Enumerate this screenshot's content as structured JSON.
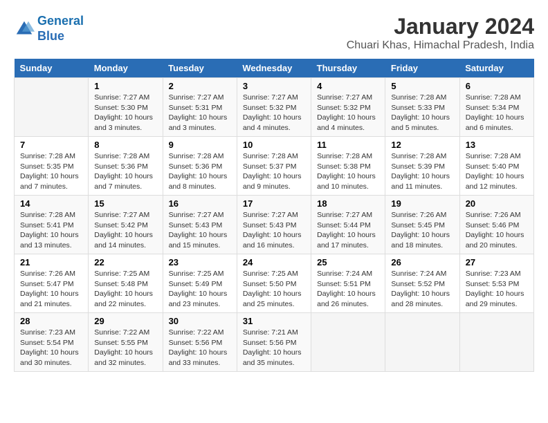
{
  "header": {
    "logo_line1": "General",
    "logo_line2": "Blue",
    "month": "January 2024",
    "location": "Chuari Khas, Himachal Pradesh, India"
  },
  "days_of_week": [
    "Sunday",
    "Monday",
    "Tuesday",
    "Wednesday",
    "Thursday",
    "Friday",
    "Saturday"
  ],
  "weeks": [
    [
      {
        "day": "",
        "info": ""
      },
      {
        "day": "1",
        "info": "Sunrise: 7:27 AM\nSunset: 5:30 PM\nDaylight: 10 hours and 3 minutes."
      },
      {
        "day": "2",
        "info": "Sunrise: 7:27 AM\nSunset: 5:31 PM\nDaylight: 10 hours and 3 minutes."
      },
      {
        "day": "3",
        "info": "Sunrise: 7:27 AM\nSunset: 5:32 PM\nDaylight: 10 hours and 4 minutes."
      },
      {
        "day": "4",
        "info": "Sunrise: 7:27 AM\nSunset: 5:32 PM\nDaylight: 10 hours and 4 minutes."
      },
      {
        "day": "5",
        "info": "Sunrise: 7:28 AM\nSunset: 5:33 PM\nDaylight: 10 hours and 5 minutes."
      },
      {
        "day": "6",
        "info": "Sunrise: 7:28 AM\nSunset: 5:34 PM\nDaylight: 10 hours and 6 minutes."
      }
    ],
    [
      {
        "day": "7",
        "info": "Sunrise: 7:28 AM\nSunset: 5:35 PM\nDaylight: 10 hours and 7 minutes."
      },
      {
        "day": "8",
        "info": "Sunrise: 7:28 AM\nSunset: 5:36 PM\nDaylight: 10 hours and 7 minutes."
      },
      {
        "day": "9",
        "info": "Sunrise: 7:28 AM\nSunset: 5:36 PM\nDaylight: 10 hours and 8 minutes."
      },
      {
        "day": "10",
        "info": "Sunrise: 7:28 AM\nSunset: 5:37 PM\nDaylight: 10 hours and 9 minutes."
      },
      {
        "day": "11",
        "info": "Sunrise: 7:28 AM\nSunset: 5:38 PM\nDaylight: 10 hours and 10 minutes."
      },
      {
        "day": "12",
        "info": "Sunrise: 7:28 AM\nSunset: 5:39 PM\nDaylight: 10 hours and 11 minutes."
      },
      {
        "day": "13",
        "info": "Sunrise: 7:28 AM\nSunset: 5:40 PM\nDaylight: 10 hours and 12 minutes."
      }
    ],
    [
      {
        "day": "14",
        "info": "Sunrise: 7:28 AM\nSunset: 5:41 PM\nDaylight: 10 hours and 13 minutes."
      },
      {
        "day": "15",
        "info": "Sunrise: 7:27 AM\nSunset: 5:42 PM\nDaylight: 10 hours and 14 minutes."
      },
      {
        "day": "16",
        "info": "Sunrise: 7:27 AM\nSunset: 5:43 PM\nDaylight: 10 hours and 15 minutes."
      },
      {
        "day": "17",
        "info": "Sunrise: 7:27 AM\nSunset: 5:43 PM\nDaylight: 10 hours and 16 minutes."
      },
      {
        "day": "18",
        "info": "Sunrise: 7:27 AM\nSunset: 5:44 PM\nDaylight: 10 hours and 17 minutes."
      },
      {
        "day": "19",
        "info": "Sunrise: 7:26 AM\nSunset: 5:45 PM\nDaylight: 10 hours and 18 minutes."
      },
      {
        "day": "20",
        "info": "Sunrise: 7:26 AM\nSunset: 5:46 PM\nDaylight: 10 hours and 20 minutes."
      }
    ],
    [
      {
        "day": "21",
        "info": "Sunrise: 7:26 AM\nSunset: 5:47 PM\nDaylight: 10 hours and 21 minutes."
      },
      {
        "day": "22",
        "info": "Sunrise: 7:25 AM\nSunset: 5:48 PM\nDaylight: 10 hours and 22 minutes."
      },
      {
        "day": "23",
        "info": "Sunrise: 7:25 AM\nSunset: 5:49 PM\nDaylight: 10 hours and 23 minutes."
      },
      {
        "day": "24",
        "info": "Sunrise: 7:25 AM\nSunset: 5:50 PM\nDaylight: 10 hours and 25 minutes."
      },
      {
        "day": "25",
        "info": "Sunrise: 7:24 AM\nSunset: 5:51 PM\nDaylight: 10 hours and 26 minutes."
      },
      {
        "day": "26",
        "info": "Sunrise: 7:24 AM\nSunset: 5:52 PM\nDaylight: 10 hours and 28 minutes."
      },
      {
        "day": "27",
        "info": "Sunrise: 7:23 AM\nSunset: 5:53 PM\nDaylight: 10 hours and 29 minutes."
      }
    ],
    [
      {
        "day": "28",
        "info": "Sunrise: 7:23 AM\nSunset: 5:54 PM\nDaylight: 10 hours and 30 minutes."
      },
      {
        "day": "29",
        "info": "Sunrise: 7:22 AM\nSunset: 5:55 PM\nDaylight: 10 hours and 32 minutes."
      },
      {
        "day": "30",
        "info": "Sunrise: 7:22 AM\nSunset: 5:56 PM\nDaylight: 10 hours and 33 minutes."
      },
      {
        "day": "31",
        "info": "Sunrise: 7:21 AM\nSunset: 5:56 PM\nDaylight: 10 hours and 35 minutes."
      },
      {
        "day": "",
        "info": ""
      },
      {
        "day": "",
        "info": ""
      },
      {
        "day": "",
        "info": ""
      }
    ]
  ]
}
